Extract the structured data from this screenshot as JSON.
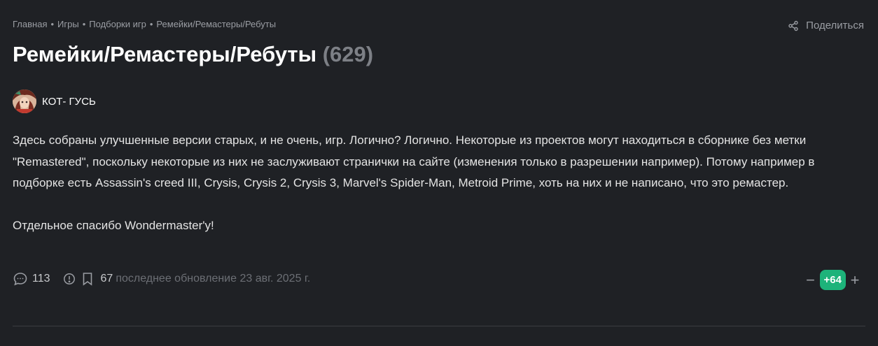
{
  "breadcrumb": {
    "items": [
      "Главная",
      "Игры",
      "Подборки игр",
      "Ремейки/Ремастеры/Ребуты"
    ],
    "separator": "•"
  },
  "share": {
    "label": "Поделиться"
  },
  "header": {
    "title": "Ремейки/Ремастеры/Ребуты",
    "count": "(629)"
  },
  "author": {
    "name": "КОТ- ГУСЬ"
  },
  "description": {
    "paragraph1": "Здесь собраны улучшенные версии старых, и не очень, игр. Логично? Логично. Некоторые из проектов могут находиться в сборнике без метки \"Remastered\", поскольку некоторые из них не заслуживают странички на сайте (изменения только в разрешении например). Потому например в подборке есть Assassin's creed III, Crysis, Crysis 2, Crysis 3, Marvel's Spider-Man, Metroid Prime, хоть на них и не написано, что это ремастер.",
    "paragraph2": "Отдельное спасибо Wondermaster'у!"
  },
  "footer": {
    "comments_count": "113",
    "bookmark_count": "67",
    "updated": "последнее обновление 23 авг. 2025 г."
  },
  "votes": {
    "minus": "−",
    "score": "+64",
    "plus": "+"
  },
  "colors": {
    "background": "#1f2125",
    "score_badge": "#1db37a",
    "muted_text": "#9a9da3"
  },
  "icons": [
    "share-icon",
    "comment-icon",
    "report-icon",
    "bookmark-icon"
  ]
}
